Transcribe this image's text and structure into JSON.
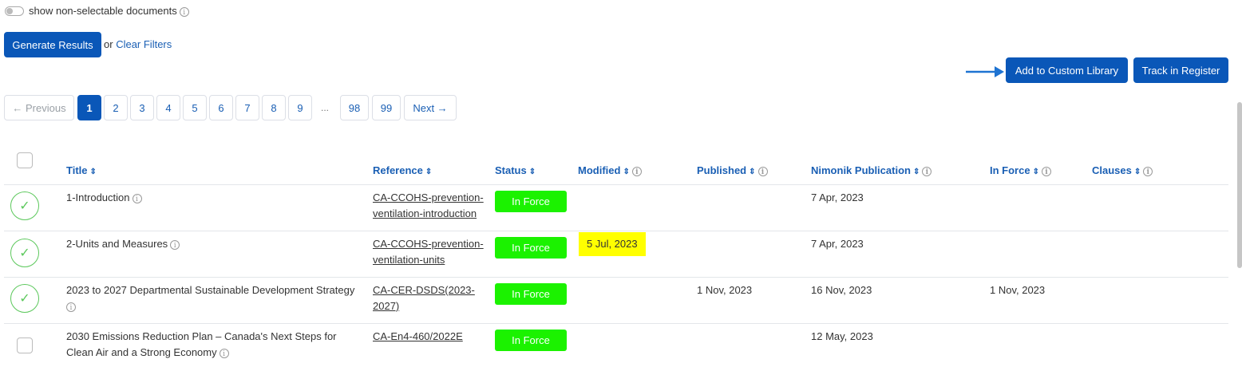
{
  "filters": {
    "toggle_label": "show non-selectable documents",
    "generate_label": "Generate Results",
    "or_text": "or",
    "clear_label": "Clear Filters"
  },
  "actions": {
    "add_library_label": "Add to Custom Library",
    "track_label": "Track in Register"
  },
  "pagination": {
    "previous": "← Previous",
    "pages": [
      "1",
      "2",
      "3",
      "4",
      "5",
      "6",
      "7",
      "8",
      "9"
    ],
    "ellipsis": "...",
    "last_pages": [
      "98",
      "99"
    ],
    "next": "Next →",
    "current": "1"
  },
  "table": {
    "headers": {
      "title": "Title",
      "reference": "Reference",
      "status": "Status",
      "modified": "Modified",
      "published": "Published",
      "nimonik": "Nimonik Publication",
      "in_force": "In Force",
      "clauses": "Clauses"
    },
    "rows": [
      {
        "title": "1-Introduction",
        "ref_line1": "CA-CCOHS-prevention-",
        "ref_line2": "ventilation-introduction",
        "status": "In Force",
        "modified": "",
        "published": "",
        "nimonik": "7 Apr, 2023",
        "in_force": "",
        "clauses": ""
      },
      {
        "title": "2-Units and Measures",
        "ref_line1": "CA-CCOHS-prevention-",
        "ref_line2": "ventilation-units",
        "status": "In Force",
        "modified": "5 Jul, 2023",
        "published": "",
        "nimonik": "7 Apr, 2023",
        "in_force": "",
        "clauses": ""
      },
      {
        "title_line1": "2023 to 2027 Departmental Sustainable Development Strategy",
        "ref_line1": "CA-CER-DSDS(2023-",
        "ref_line2": "2027)",
        "status": "In Force",
        "modified": "",
        "published": "1 Nov, 2023",
        "nimonik": "16 Nov, 2023",
        "in_force": "1 Nov, 2023",
        "clauses": ""
      },
      {
        "title_line1": "2030 Emissions Reduction Plan – Canada's Next Steps for",
        "title_line2": "Clean Air and a Strong Economy",
        "ref_line1": "CA-En4-460/2022E",
        "status": "In Force",
        "modified": "",
        "published": "",
        "nimonik": "12 May, 2023",
        "in_force": "",
        "clauses": ""
      }
    ]
  },
  "colors": {
    "primary": "#0a57b8",
    "status_green": "#1bf200",
    "highlight_yellow": "#ffff00",
    "selected_green": "#5cc85c"
  }
}
